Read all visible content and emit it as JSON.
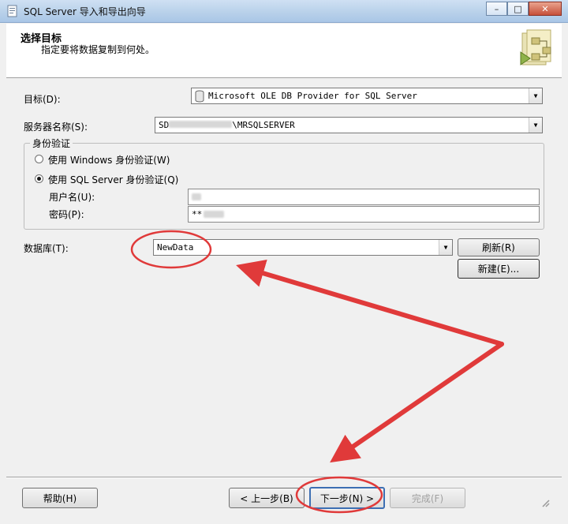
{
  "window": {
    "title": "SQL Server 导入和导出向导",
    "app_icon": "document-icon",
    "controls": {
      "minimize": "–",
      "maximize": "□",
      "close": "✕"
    }
  },
  "header": {
    "title": "选择目标",
    "subtitle": "指定要将数据复制到何处。",
    "icon": "wizard-export-icon"
  },
  "form": {
    "destination_label": "目标(D):",
    "destination_value": "Microsoft OLE DB Provider for SQL Server",
    "server_label": "服务器名称(S):",
    "server_value_prefix": "SD",
    "server_value_suffix": "\\MRSQLSERVER",
    "auth_group_title": "身份验证",
    "auth_windows_label": "使用 Windows 身份验证(W)",
    "auth_sql_label": "使用 SQL Server 身份验证(Q)",
    "selected_auth": "sql",
    "username_label": "用户名(U):",
    "username_value": "",
    "password_label": "密码(P):",
    "password_value": "**",
    "database_label": "数据库(T):",
    "database_value": "NewData",
    "refresh_button": "刷新(R)",
    "new_button": "新建(E)..."
  },
  "footer": {
    "help_button": "帮助(H)",
    "back_button": "< 上一步(B)",
    "next_button": "下一步(N) >",
    "finish_button": "完成(F)"
  },
  "colors": {
    "annotation": "#e03a3a",
    "header_bg": "#ffffff",
    "window_bg": "#f0f0f0"
  }
}
